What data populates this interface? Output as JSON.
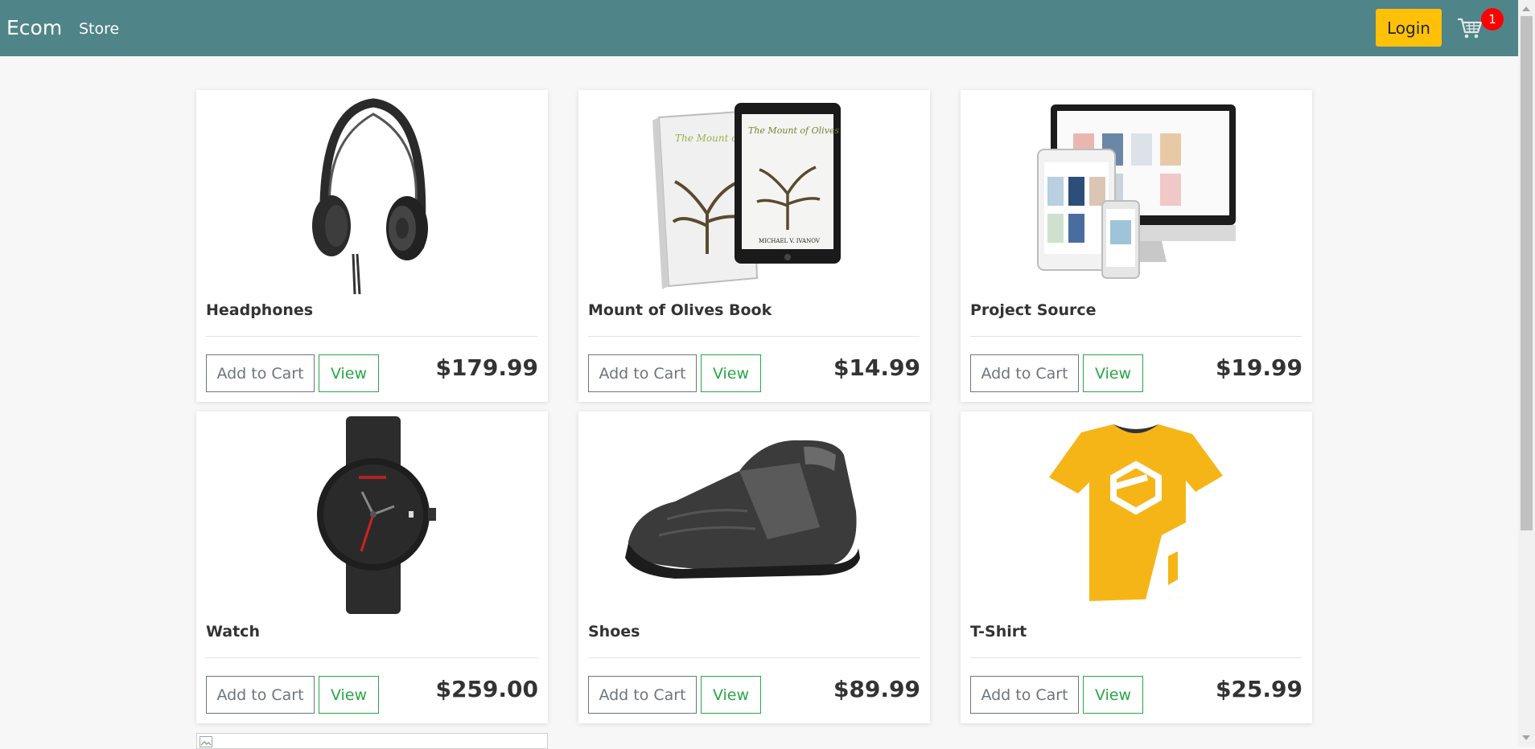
{
  "navbar": {
    "brand": "Ecom",
    "links": [
      "Store"
    ],
    "login_label": "Login",
    "cart_count": "1",
    "cart_icon": "shopping-cart-icon"
  },
  "colors": {
    "navbar": "#4f8489",
    "login": "#ffc107",
    "view_button": "#28a745",
    "add_button": "#6c757d",
    "badge": "#ff0000"
  },
  "products": [
    {
      "name": "Headphones",
      "price": "$179.99",
      "add_label": "Add to Cart",
      "view_label": "View",
      "image": "headphones-image"
    },
    {
      "name": "Mount of Olives Book",
      "price": "$14.99",
      "add_label": "Add to Cart",
      "view_label": "View",
      "image": "book-image",
      "image_text": {
        "book_title": "The Mount of Olives",
        "author": "MICHAEL V. IVANOV"
      }
    },
    {
      "name": "Project Source",
      "price": "$19.99",
      "add_label": "Add to Cart",
      "view_label": "View",
      "image": "devices-image"
    },
    {
      "name": "Watch",
      "price": "$259.00",
      "add_label": "Add to Cart",
      "view_label": "View",
      "image": "watch-image"
    },
    {
      "name": "Shoes",
      "price": "$89.99",
      "add_label": "Add to Cart",
      "view_label": "View",
      "image": "shoe-image"
    },
    {
      "name": "T-Shirt",
      "price": "$25.99",
      "add_label": "Add to Cart",
      "view_label": "View",
      "image": "tshirt-image"
    }
  ]
}
